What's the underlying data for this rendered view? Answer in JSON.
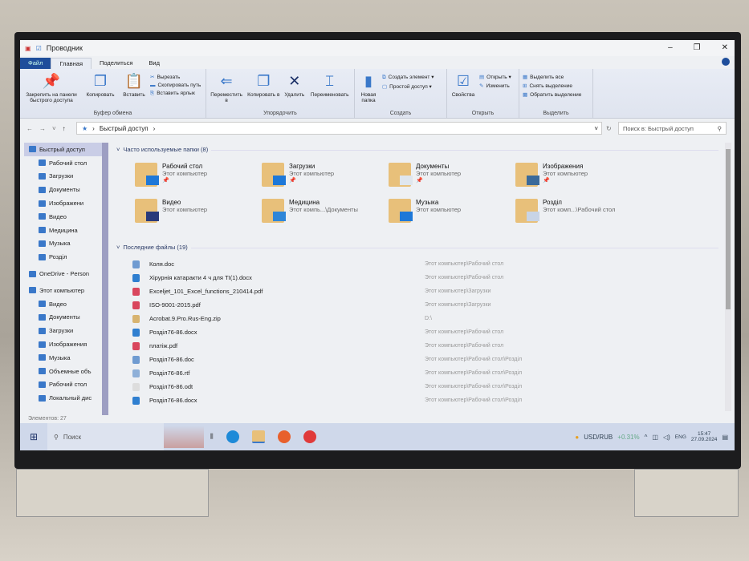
{
  "window": {
    "title": "Проводник"
  },
  "tabs": [
    "Файл",
    "Главная",
    "Поделиться",
    "Вид"
  ],
  "ribbon": {
    "clipboard": {
      "pin": "Закрепить на панели быстрого доступа",
      "copy": "Копировать",
      "paste": "Вставить",
      "cut": "Вырезать",
      "copy_path": "Скопировать путь",
      "paste_shortcut": "Вставить ярлык",
      "label": "Буфер обмена"
    },
    "organize": {
      "move": "Переместить в",
      "copy": "Копировать в",
      "delete": "Удалить",
      "rename": "Переименовать",
      "label": "Упорядочить"
    },
    "create": {
      "new_folder": "Новая папка",
      "new_item": "Создать элемент",
      "easy_access": "Простой доступ",
      "label": "Создать"
    },
    "open": {
      "properties": "Свойства",
      "open": "Открыть",
      "edit": "Изменить",
      "label": "Открыть"
    },
    "select": {
      "select_all": "Выделить все",
      "select_none": "Снять выделение",
      "invert": "Обратить выделение",
      "label": "Выделить"
    }
  },
  "address": {
    "path": "Быстрый доступ",
    "search_placeholder": "Поиск в: Быстрый доступ"
  },
  "sidebar": [
    {
      "label": "Быстрый доступ",
      "level": 0,
      "selected": true
    },
    {
      "label": "Рабочий стол",
      "level": 1
    },
    {
      "label": "Загрузки",
      "level": 1
    },
    {
      "label": "Документы",
      "level": 1
    },
    {
      "label": "Изображени",
      "level": 1
    },
    {
      "label": "Видео",
      "level": 1
    },
    {
      "label": "Медицина",
      "level": 1
    },
    {
      "label": "Музыка",
      "level": 1
    },
    {
      "label": "Розділ",
      "level": 1
    },
    {
      "label": "OneDrive - Person",
      "level": 0
    },
    {
      "label": "Этот компьютер",
      "level": 0
    },
    {
      "label": "Видео",
      "level": 1
    },
    {
      "label": "Документы",
      "level": 1
    },
    {
      "label": "Загрузки",
      "level": 1
    },
    {
      "label": "Изображения",
      "level": 1
    },
    {
      "label": "Музыка",
      "level": 1
    },
    {
      "label": "Объемные объ",
      "level": 1
    },
    {
      "label": "Рабочий стол",
      "level": 1
    },
    {
      "label": "Локальный дис",
      "level": 1
    }
  ],
  "frequent": {
    "title": "Часто используемые папки (8)",
    "items": [
      {
        "name": "Рабочий стол",
        "sub": "Этот компьютер",
        "pinned": true,
        "color": "#1e78d8"
      },
      {
        "name": "Загрузки",
        "sub": "Этот компьютер",
        "pinned": true,
        "color": "#1e78d8"
      },
      {
        "name": "Документы",
        "sub": "Этот компьютер",
        "pinned": true,
        "color": "#dfe6ee"
      },
      {
        "name": "Изображения",
        "sub": "Этот компьютер",
        "pinned": true,
        "color": "#3b6a9a"
      },
      {
        "name": "Видео",
        "sub": "Этот компьютер",
        "pinned": false,
        "color": "#2a3a7a"
      },
      {
        "name": "Медицина",
        "sub": "Этот компь...\\Документы",
        "pinned": false,
        "color": "#2f86d8"
      },
      {
        "name": "Музыка",
        "sub": "Этот компьютер",
        "pinned": false,
        "color": "#1e78d8"
      },
      {
        "name": "Розділ",
        "sub": "Этот комп...\\Рабочий стол",
        "pinned": false,
        "color": "#c8d4e6"
      }
    ]
  },
  "recent": {
    "title": "Последние файлы (19)",
    "items": [
      {
        "name": "Коля.doc",
        "loc": "Этот компьютер\\Рабочий стол",
        "color": "#6f9bd1"
      },
      {
        "name": "Хірурнія катаракти 4 ч для TI(1).docx",
        "loc": "Этот компьютер\\Рабочий стол",
        "color": "#2f7fd0"
      },
      {
        "name": "Exceljet_101_Excel_functions_210414.pdf",
        "loc": "Этот компьютер\\Загрузки",
        "color": "#d9465d"
      },
      {
        "name": "ISO-9001-2015.pdf",
        "loc": "Этот компьютер\\Загрузки",
        "color": "#d9465d"
      },
      {
        "name": "Acrobat.9.Pro.Rus-Eng.zip",
        "loc": "D:\\",
        "color": "#d8b470"
      },
      {
        "name": "Розділ76-86.docx",
        "loc": "Этот компьютер\\Рабочий стол",
        "color": "#2f7fd0"
      },
      {
        "name": "платіж.pdf",
        "loc": "Этот компьютер\\Рабочий стол",
        "color": "#d9465d"
      },
      {
        "name": "Розділ76-86.doc",
        "loc": "Этот компьютер\\Рабочий стол\\Розділ",
        "color": "#6f9bd1"
      },
      {
        "name": "Розділ76-86.rtf",
        "loc": "Этот компьютер\\Рабочий стол\\Розділ",
        "color": "#8fb0d8"
      },
      {
        "name": "Розділ76-86.odt",
        "loc": "Этот компьютер\\Рабочий стол\\Розділ",
        "color": "#dddddd"
      },
      {
        "name": "Розділ76-86.docx",
        "loc": "Этот компьютер\\Рабочий стол\\Розділ",
        "color": "#2f7fd0"
      }
    ]
  },
  "status": "Элементов: 27",
  "taskbar": {
    "search": "Поиск",
    "ticker": "USD/RUB",
    "change": "+0.31%",
    "lang": "ENG",
    "time": "15:47",
    "date": "27.09.2024"
  }
}
